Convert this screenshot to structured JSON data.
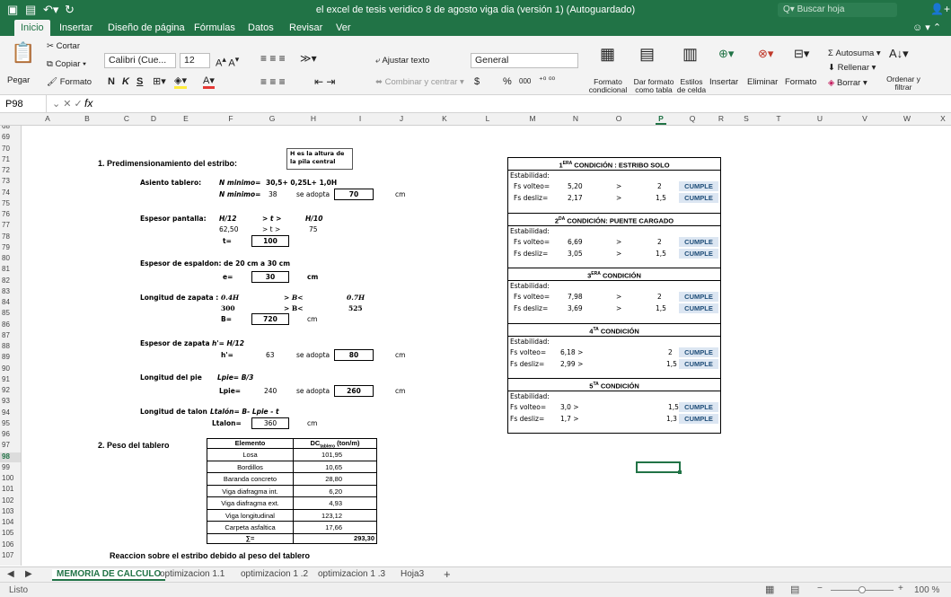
{
  "title_bar": {
    "title": "el excel de tesis veridico 8 de agosto viga dia (versión 1) (Autoguardado)",
    "search_placeholder": "Q▾ Buscar hoja",
    "accent": "#217346"
  },
  "ribbon_tabs": [
    "Inicio",
    "Insertar",
    "Diseño de página",
    "Fórmulas",
    "Datos",
    "Revisar",
    "Ver"
  ],
  "ribbon": {
    "paste": "Pegar",
    "cut": "Cortar",
    "copy": "Copiar ▾",
    "format_painter": "Formato",
    "font": "Calibri (Cue...",
    "font_size": "12",
    "bold": "N",
    "italic": "K",
    "underline": "S",
    "wrap": "Ajustar texto",
    "merge": "Combinar y centrar ▾",
    "number_format": "General",
    "currency": "$",
    "percent": "%",
    "thousands": "000",
    "cond_format": "Formato condicional",
    "table_format": "Dar formato como tabla",
    "cell_styles": "Estilos de celda",
    "insert": "Insertar",
    "delete": "Eliminar",
    "format": "Formato",
    "autosum": "Autosuma ▾",
    "fill": "Rellenar ▾",
    "clear": "Borrar ▾",
    "sort": "Ordenar y filtrar"
  },
  "formula_bar": {
    "cell_ref": "P98",
    "fx": "fx",
    "value": ""
  },
  "columns": [
    "A",
    "B",
    "C",
    "D",
    "E",
    "F",
    "G",
    "H",
    "I",
    "J",
    "K",
    "L",
    "M",
    "N",
    "O",
    "P",
    "Q",
    "R",
    "S",
    "T",
    "U",
    "V",
    "W",
    "X"
  ],
  "rows": [
    "68",
    "69",
    "70",
    "71",
    "72",
    "73",
    "74",
    "75",
    "76",
    "77",
    "78",
    "79",
    "80",
    "81",
    "82",
    "83",
    "84",
    "85",
    "86",
    "87",
    "88",
    "89",
    "90",
    "91",
    "92",
    "93",
    "94",
    "95",
    "96",
    "97",
    "98",
    "99",
    "100",
    "101",
    "102",
    "103",
    "104",
    "105",
    "106",
    "107"
  ],
  "selected_column": "P",
  "selected_row": "98",
  "sheet": {
    "s1_title": "1.  Predimensionamiento del estribo:",
    "note": "H es la altura de la pila central",
    "asiento": {
      "label": "Asiento tablero:",
      "n_formula_label": "N minimo=",
      "n_formula": "30,5+ 0,25L+ 1,0H",
      "n_min_label": "N minimo=",
      "n_val": "38",
      "adopta": "se adopta",
      "adopted": "70",
      "unit": "cm"
    },
    "espesor_pantalla": {
      "label": "Espesor  pantalla:",
      "h12": "H/12",
      "gt1": "> t >",
      "h10": "H/10",
      "v1": "62,50",
      "gt2": "> t >",
      "v2": "75",
      "t_label": "t=",
      "t_val": "100"
    },
    "espaldon": {
      "label": "Espesor de espaldon: de 20 cm a 30 cm",
      "e_label": "e=",
      "e_val": "30",
      "unit": "cm"
    },
    "zapata": {
      "label": "Longitud de zapata :",
      "f1": "0.4H",
      "gt1": "> B<",
      "f2": "0.7H",
      "v1": "300",
      "gt2": "> B<",
      "v2": "525",
      "b_label": "B=",
      "b_val": "720",
      "unit": "cm"
    },
    "espesor_zapata": {
      "label": "Espesor de zapata",
      "formula": "h'= H/12",
      "h_label": "h'=",
      "h_val": "63",
      "adopta": "se adopta",
      "adopted": "80",
      "unit": "cm"
    },
    "pie": {
      "label": "Longitud del pie",
      "formula": "Lpie= B/3",
      "l_label": "Lpie=",
      "l_val": "240",
      "adopta": "se adopta",
      "adopted": "260",
      "unit": "cm"
    },
    "talon": {
      "label": "Longitud de talon",
      "formula": "Ltalón= B- Lpie - t",
      "l_label": "Ltalon=",
      "l_val": "360",
      "unit": "cm"
    },
    "s2_title": "2.  Peso del tablero",
    "peso_header": {
      "elemento": "Elemento",
      "dc": "DC",
      "dc_sub": "tablero",
      "dc_unit": " (ton/m)"
    },
    "peso_rows": [
      {
        "name": "Losa",
        "val": "101,95"
      },
      {
        "name": "Bordillos",
        "val": "10,65"
      },
      {
        "name": "Baranda concreto",
        "val": "28,80"
      },
      {
        "name": "Viga diafragma int.",
        "val": "6,20"
      },
      {
        "name": "Viga diafragma ext.",
        "val": "4,93"
      },
      {
        "name": "Viga longitudinal",
        "val": "123,12"
      },
      {
        "name": "Carpeta asfaltica",
        "val": "17,66"
      }
    ],
    "peso_total": {
      "label": "∑=",
      "val": "293,30"
    },
    "reaccion": "Reaccion sobre el estribo debido al peso del tablero"
  },
  "conditions": [
    {
      "num": "1",
      "sup": "ERA",
      "title": " CONDICIÓN : ESTRIBO SOLO",
      "est": "Estabilidad:",
      "v_label": "Fs volteo=",
      "v_val": "5,20",
      "v_op": ">",
      "v_lim": "2",
      "v_res": "CUMPLE",
      "d_label": "Fs desliz=",
      "d_val": "2,17",
      "d_op": ">",
      "d_lim": "1,5",
      "d_res": "CUMPLE"
    },
    {
      "num": "2",
      "sup": "DA",
      "title": " CONDICIÓN: PUENTE CARGADO",
      "est": "Estabilidad:",
      "v_label": "Fs volteo=",
      "v_val": "6,69",
      "v_op": ">",
      "v_lim": "2",
      "v_res": "CUMPLE",
      "d_label": "Fs desliz=",
      "d_val": "3,05",
      "d_op": ">",
      "d_lim": "1,5",
      "d_res": "CUMPLE"
    },
    {
      "num": "3",
      "sup": "ERA",
      "title": " CONDICIÓN",
      "est": "Estabilidad:",
      "v_label": "Fs volteo=",
      "v_val": "7,98",
      "v_op": ">",
      "v_lim": "2",
      "v_res": "CUMPLE",
      "d_label": "Fs desliz=",
      "d_val": "3,69",
      "d_op": ">",
      "d_lim": "1,5",
      "d_res": "CUMPLE"
    },
    {
      "num": "4",
      "sup": "TA",
      "title": " CONDICIÓN",
      "est": "Estabilidad:",
      "v_label": "Fs volteo=",
      "v_val": "6,18 >",
      "v_op": "",
      "v_lim": "2",
      "v_res": "CUMPLE",
      "d_label": "Fs desliz=",
      "d_val": "2,99 >",
      "d_op": "",
      "d_lim": "1,5",
      "d_res": "CUMPLE"
    },
    {
      "num": "5",
      "sup": "TA",
      "title": " CONDICIÓN",
      "est": "Estabilidad:",
      "v_label": "Fs volteo=",
      "v_val": "3,0 >",
      "v_op": "",
      "v_lim": "1,5",
      "v_res": "CUMPLE",
      "d_label": "Fs desliz=",
      "d_val": "1,7 >",
      "d_op": "",
      "d_lim": "1,3",
      "d_res": "CUMPLE"
    }
  ],
  "sheet_tabs": [
    "MEMORIA DE CALCULO",
    "optimizacion 1.1",
    "optimizacion 1 .2",
    "optimizacion 1 .3",
    "Hoja3"
  ],
  "add_sheet": "+",
  "status": {
    "ready": "Listo",
    "zoom": "100 %",
    "zoom_minus": "−",
    "zoom_plus": "+"
  }
}
